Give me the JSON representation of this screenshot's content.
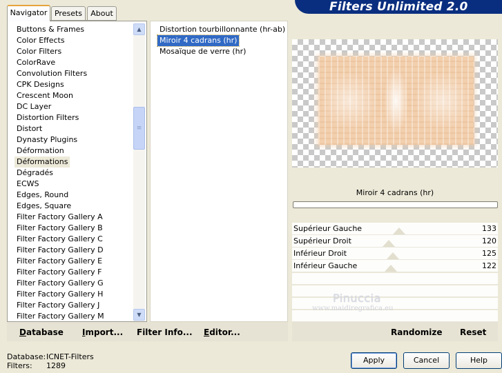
{
  "tabs": [
    "Navigator",
    "Presets",
    "About"
  ],
  "banner": "Filters Unlimited 2.0",
  "categories": [
    "Buttons & Frames",
    "Color Effects",
    "Color Filters",
    "ColorRave",
    "Convolution Filters",
    "CPK Designs",
    "Crescent Moon",
    "DC Layer",
    "Distortion Filters",
    "Distort",
    "Dynasty Plugins",
    "Déformation",
    "Déformations",
    "Dégradés",
    "ECWS",
    "Edges, Round",
    "Edges, Square",
    "Filter Factory Gallery A",
    "Filter Factory Gallery B",
    "Filter Factory Gallery C",
    "Filter Factory Gallery D",
    "Filter Factory Gallery E",
    "Filter Factory Gallery F",
    "Filter Factory Gallery G",
    "Filter Factory Gallery H",
    "Filter Factory Gallery J",
    "Filter Factory Gallery M"
  ],
  "selected_category": "Déformations",
  "filters": [
    "Distortion tourbillonnante (hr-ab)",
    "Miroir 4 cadrans (hr)",
    "Mosaïque de verre (hr)"
  ],
  "selected_filter": "Miroir 4 cadrans (hr)",
  "filter_title": "Miroir 4 cadrans (hr)",
  "sliders": [
    {
      "label": "Supérieur Gauche",
      "value": "133",
      "level": 0.52
    },
    {
      "label": "Supérieur Droit",
      "value": "120",
      "level": 0.47
    },
    {
      "label": "Inférieur Droit",
      "value": "125",
      "level": 0.49
    },
    {
      "label": "Inférieur Gauche",
      "value": "122",
      "level": 0.48
    }
  ],
  "watermark": {
    "name": "Pinuccia",
    "url": "www.maidiregrafica.eu"
  },
  "left_toolbar": [
    {
      "u": "D",
      "rest": "atabase"
    },
    {
      "u": "I",
      "rest": "mport..."
    },
    {
      "u": "",
      "rest": "Filter Info..."
    },
    {
      "u": "E",
      "rest": "ditor..."
    }
  ],
  "right_toolbar": {
    "randomize": "Randomize",
    "reset": "Reset"
  },
  "status": {
    "database_label": "Database:",
    "database_value": "ICNET-Filters",
    "filters_label": "Filters:",
    "filters_value": "1289"
  },
  "buttons": {
    "apply": "Apply",
    "cancel": "Cancel",
    "help": "Help"
  }
}
